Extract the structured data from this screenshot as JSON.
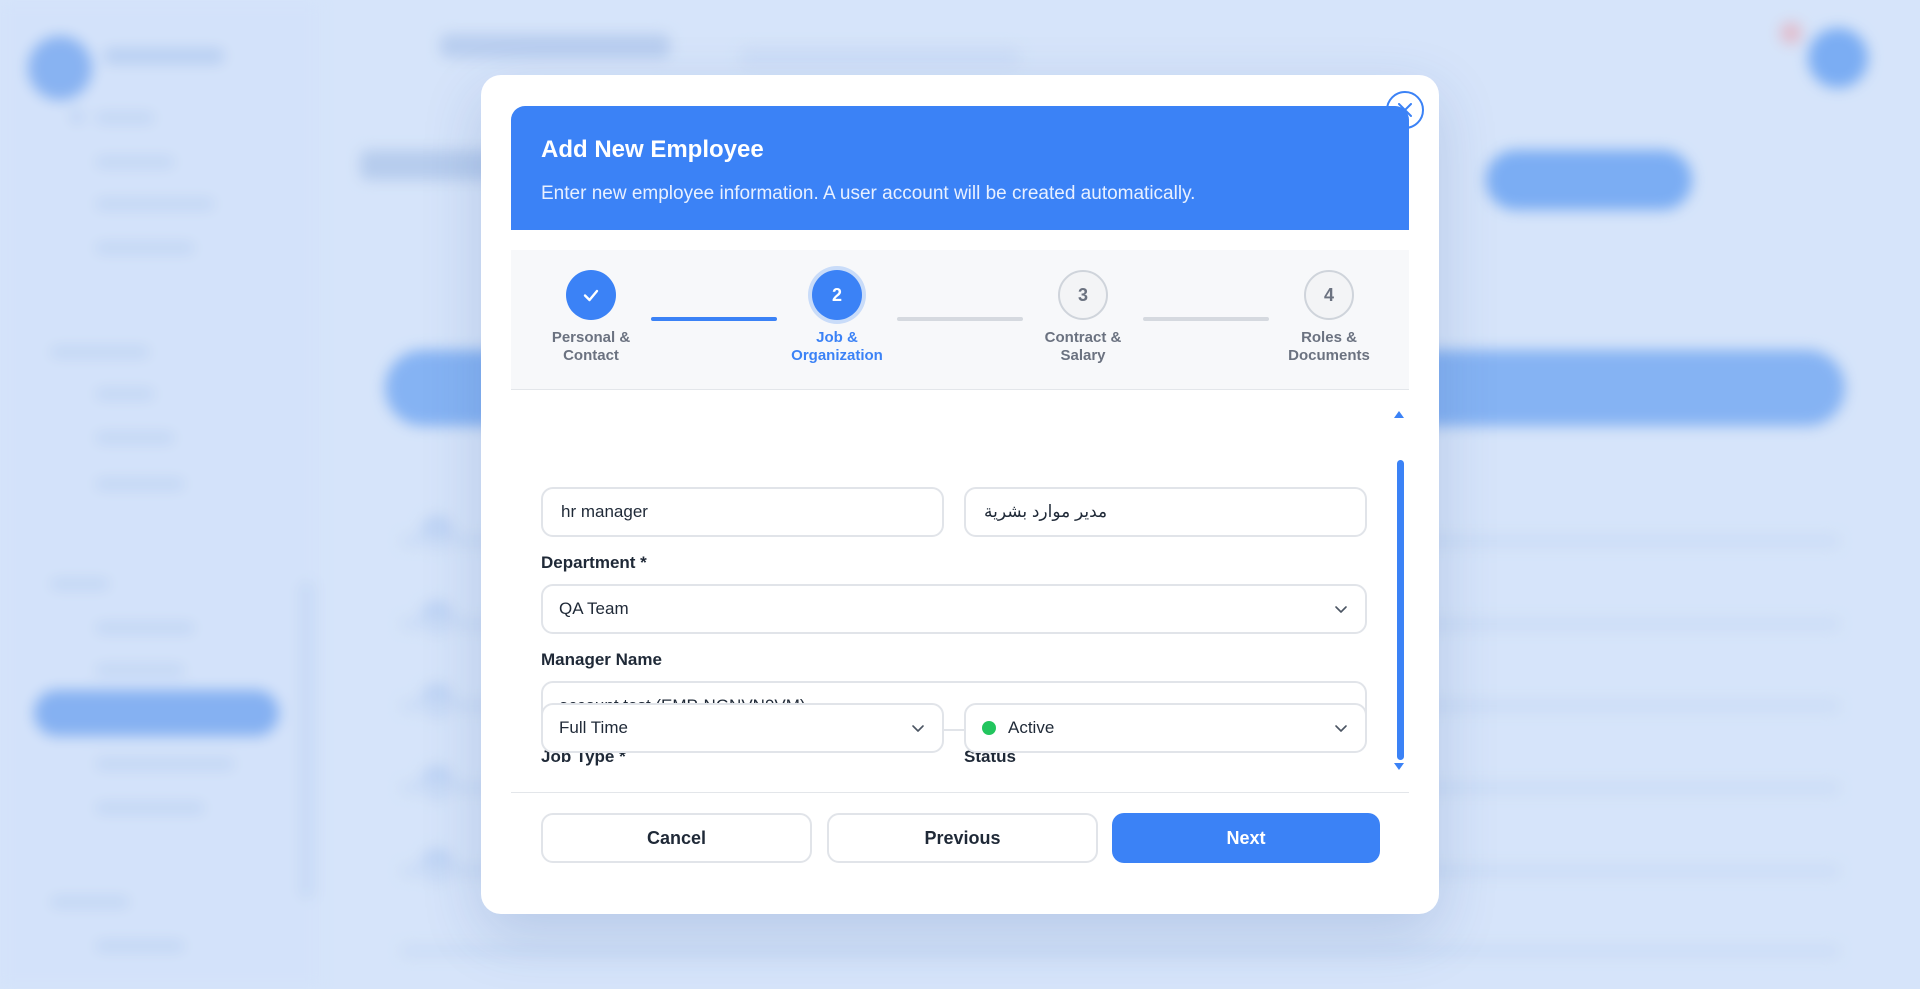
{
  "modal": {
    "title": "Add New Employee",
    "subtitle": "Enter new employee information. A user account will be created automatically."
  },
  "stepper": {
    "steps": [
      {
        "number": "1",
        "label_line1": "Personal &",
        "label_line2": "Contact",
        "state": "done"
      },
      {
        "number": "2",
        "label_line1": "Job &",
        "label_line2": "Organization",
        "state": "active"
      },
      {
        "number": "3",
        "label_line1": "Contract &",
        "label_line2": "Salary",
        "state": "todo"
      },
      {
        "number": "4",
        "label_line1": "Roles &",
        "label_line2": "Documents",
        "state": "todo"
      }
    ]
  },
  "form": {
    "job_title_en": "hr manager",
    "job_title_ar": "مدير موارد بشرية",
    "department_label": "Department *",
    "department_value": "QA Team",
    "manager_label": "Manager Name",
    "manager_value": "account test (EMP-NGNVN9VM)",
    "job_type_label": "Job Type *",
    "job_type_value": "Full Time",
    "status_label": "Status",
    "status_value": "Active"
  },
  "buttons": {
    "cancel": "Cancel",
    "previous": "Previous",
    "next": "Next"
  },
  "colors": {
    "accent": "#3b82f6",
    "status_active": "#22c55e"
  }
}
